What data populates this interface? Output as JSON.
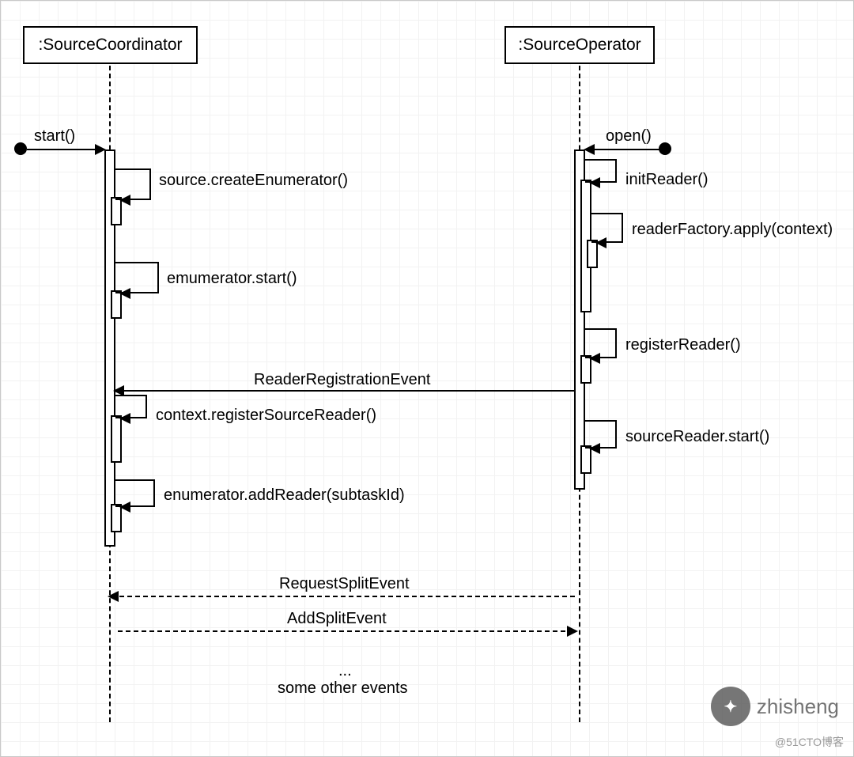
{
  "participants": {
    "left": ":SourceCoordinator",
    "right": ":SourceOperator"
  },
  "messages": {
    "start": "start()",
    "open": "open()",
    "createEnum": "source.createEnumerator()",
    "initReader": "initReader()",
    "readerFactory": "readerFactory.apply(context)",
    "emumStart": "emumerator.start()",
    "registerReader": "registerReader()",
    "readerRegEvent": "ReaderRegistrationEvent",
    "contextRegister": "context.registerSourceReader()",
    "sourceReaderStart": "sourceReader.start()",
    "enumAddReader": "enumerator.addReader(subtaskId)",
    "requestSplit": "RequestSplitEvent",
    "addSplit": "AddSplitEvent",
    "ellipsis": "...",
    "otherEvents": "some other events"
  },
  "watermark": {
    "brand": "zhisheng",
    "platform": "@51CTO博客"
  }
}
